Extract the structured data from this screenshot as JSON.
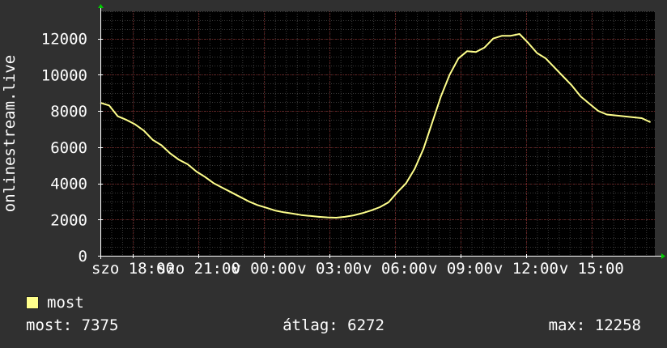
{
  "chart_data": {
    "type": "line",
    "ylabel": "onlinestream.live",
    "ylim": [
      0,
      13500
    ],
    "yticks": [
      0,
      2000,
      4000,
      6000,
      8000,
      10000,
      12000
    ],
    "ytick_labels": [
      "0",
      "2000",
      "4000",
      "6000",
      "8000",
      "10000",
      "12000"
    ],
    "xlim_hours": [
      16.5,
      16.5
    ],
    "xticks": [
      {
        "label": "szo 18:00",
        "hours_from_start": 1.5
      },
      {
        "label": "szo 21:00",
        "hours_from_start": 4.5
      },
      {
        "label": "v 00:00",
        "hours_from_start": 7.5
      },
      {
        "label": "v 03:00",
        "hours_from_start": 10.5
      },
      {
        "label": "v 06:00",
        "hours_from_start": 13.5
      },
      {
        "label": "v 09:00",
        "hours_from_start": 16.5
      },
      {
        "label": "v 12:00",
        "hours_from_start": 19.5
      },
      {
        "label": "v 15:00",
        "hours_from_start": 22.5
      }
    ],
    "grid": true,
    "series": [
      {
        "name": "most",
        "color": "#ffff8c",
        "points": [
          [
            0.0,
            8450
          ],
          [
            0.4,
            8300
          ],
          [
            0.8,
            7700
          ],
          [
            1.2,
            7500
          ],
          [
            1.6,
            7250
          ],
          [
            2.0,
            6900
          ],
          [
            2.4,
            6400
          ],
          [
            2.8,
            6100
          ],
          [
            3.2,
            5650
          ],
          [
            3.6,
            5300
          ],
          [
            4.0,
            5050
          ],
          [
            4.4,
            4650
          ],
          [
            4.8,
            4350
          ],
          [
            5.2,
            4000
          ],
          [
            5.6,
            3750
          ],
          [
            6.0,
            3500
          ],
          [
            6.4,
            3250
          ],
          [
            6.8,
            3000
          ],
          [
            7.2,
            2800
          ],
          [
            7.6,
            2650
          ],
          [
            8.0,
            2500
          ],
          [
            8.4,
            2400
          ],
          [
            8.8,
            2330
          ],
          [
            9.2,
            2250
          ],
          [
            9.6,
            2200
          ],
          [
            10.0,
            2150
          ],
          [
            10.4,
            2120
          ],
          [
            10.8,
            2100
          ],
          [
            11.2,
            2150
          ],
          [
            11.6,
            2230
          ],
          [
            12.0,
            2350
          ],
          [
            12.4,
            2500
          ],
          [
            12.8,
            2680
          ],
          [
            13.2,
            2950
          ],
          [
            13.6,
            3500
          ],
          [
            14.0,
            4000
          ],
          [
            14.4,
            4800
          ],
          [
            14.8,
            5900
          ],
          [
            15.2,
            7350
          ],
          [
            15.6,
            8800
          ],
          [
            16.0,
            10000
          ],
          [
            16.4,
            10900
          ],
          [
            16.8,
            11300
          ],
          [
            17.2,
            11250
          ],
          [
            17.6,
            11500
          ],
          [
            18.0,
            12000
          ],
          [
            18.4,
            12150
          ],
          [
            18.8,
            12150
          ],
          [
            19.2,
            12250
          ],
          [
            19.6,
            11750
          ],
          [
            20.0,
            11200
          ],
          [
            20.4,
            10900
          ],
          [
            20.8,
            10400
          ],
          [
            21.2,
            9900
          ],
          [
            21.6,
            9400
          ],
          [
            22.0,
            8800
          ],
          [
            22.4,
            8400
          ],
          [
            22.8,
            8000
          ],
          [
            23.2,
            7800
          ],
          [
            23.6,
            7750
          ],
          [
            24.0,
            7700
          ],
          [
            24.4,
            7650
          ],
          [
            24.8,
            7600
          ],
          [
            25.2,
            7375
          ]
        ]
      }
    ]
  },
  "legend": {
    "label": "most",
    "color": "#ffff8c"
  },
  "stats": {
    "current": "most: 7375",
    "average": "átlag: 6272",
    "max": "max: 12258"
  },
  "colors": {
    "background": "#303030",
    "plot_background": "#000000",
    "grid_major": "#6b1f1f",
    "grid_minor": "#3a3a3a",
    "axis": "#ffffff",
    "arrow": "#00cc00"
  }
}
